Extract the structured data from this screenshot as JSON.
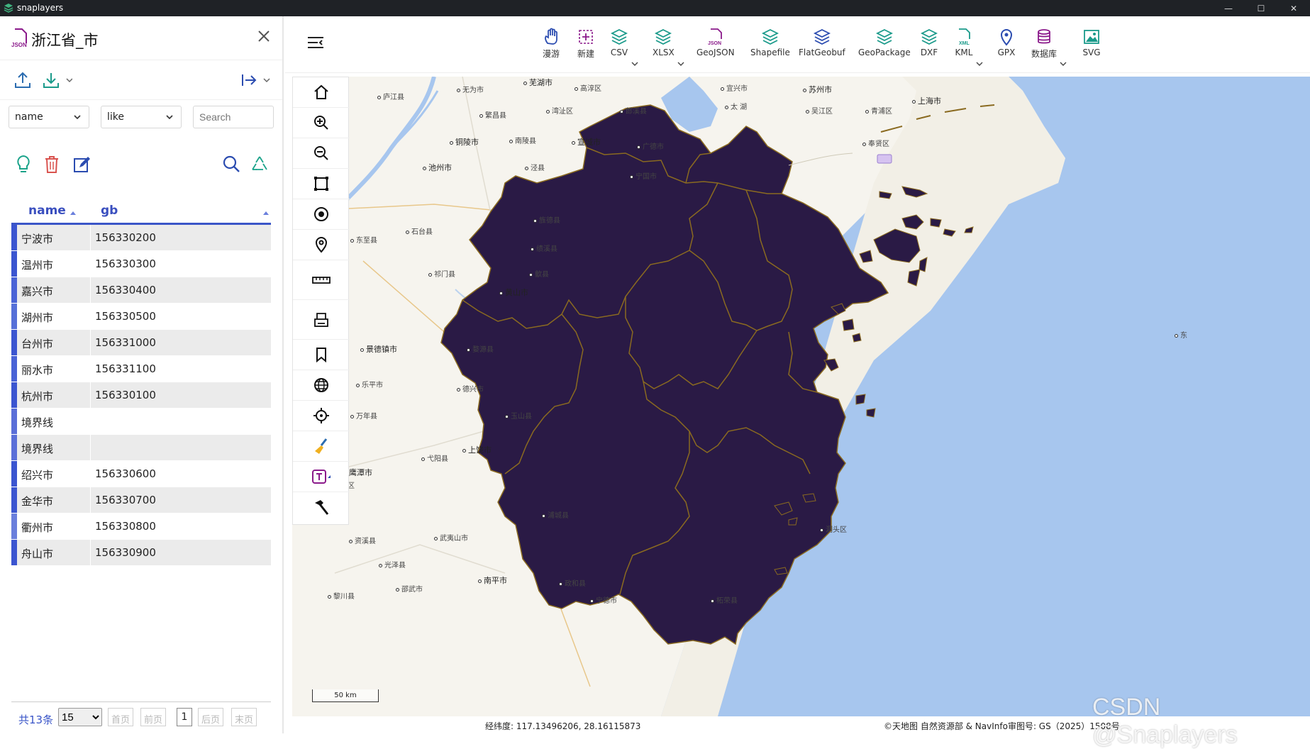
{
  "window": {
    "app_name": "snaplayers",
    "controls": [
      "—",
      "☐",
      "✕"
    ]
  },
  "layer_panel": {
    "title": "浙江省_市",
    "filter": {
      "field": "name",
      "operator": "like",
      "search_placeholder": "Search"
    },
    "columns": [
      "name",
      "gb"
    ],
    "rows": [
      {
        "name": "宁波市",
        "gb": "156330200",
        "color": "#3b55d0"
      },
      {
        "name": "温州市",
        "gb": "156330300",
        "color": "#3b55d0"
      },
      {
        "name": "嘉兴市",
        "gb": "156330400",
        "color": "#4a63d6"
      },
      {
        "name": "湖州市",
        "gb": "156330500",
        "color": "#5670d8"
      },
      {
        "name": "台州市",
        "gb": "156331000",
        "color": "#3b55d0"
      },
      {
        "name": "丽水市",
        "gb": "156331100",
        "color": "#4a63d6"
      },
      {
        "name": "杭州市",
        "gb": "156330100",
        "color": "#3b55d0"
      },
      {
        "name": "境界线",
        "gb": "",
        "color": "#5a6fd8"
      },
      {
        "name": "境界线",
        "gb": "",
        "color": "#5a6fd8"
      },
      {
        "name": "绍兴市",
        "gb": "156330600",
        "color": "#3b55d0"
      },
      {
        "name": "金华市",
        "gb": "156330700",
        "color": "#3b55d0"
      },
      {
        "name": "衢州市",
        "gb": "156330800",
        "color": "#6a7fdc"
      },
      {
        "name": "舟山市",
        "gb": "156330900",
        "color": "#3b55d0"
      }
    ],
    "pager": {
      "total": "共13条",
      "page_size": "15",
      "first": "首页",
      "prev": "前页",
      "current": "1",
      "next": "后页",
      "last": "末页"
    }
  },
  "toolbar": {
    "items": [
      {
        "label": "漫游",
        "icon": "hand-icon",
        "dropdown": false
      },
      {
        "label": "新建",
        "icon": "new-layer-icon",
        "dropdown": false
      },
      {
        "label": "CSV",
        "icon": "csv-layers-icon",
        "dropdown": true
      },
      {
        "label": "XLSX",
        "icon": "xlsx-layers-icon",
        "dropdown": true
      },
      {
        "label": "GeoJSON",
        "icon": "geojson-file-icon",
        "dropdown": false
      },
      {
        "label": "Shapefile",
        "icon": "shapefile-layers-icon",
        "dropdown": false
      },
      {
        "label": "FlatGeobuf",
        "icon": "flatgeobuf-layers-icon",
        "dropdown": false
      },
      {
        "label": "GeoPackage",
        "icon": "geopackage-layers-icon",
        "dropdown": false
      },
      {
        "label": "DXF",
        "icon": "dxf-layers-icon",
        "dropdown": false
      },
      {
        "label": "KML",
        "icon": "kml-file-icon",
        "dropdown": true
      },
      {
        "label": "GPX",
        "icon": "gpx-pin-icon",
        "dropdown": false
      },
      {
        "label": "数据库",
        "icon": "database-icon",
        "dropdown": true
      },
      {
        "label": "SVG",
        "icon": "svg-image-icon",
        "dropdown": false
      }
    ]
  },
  "map": {
    "fill_color": "#2a1a45",
    "border_color": "#8a6a20",
    "water_color": "#a7c6ee",
    "land_color": "#f6f4ee",
    "labels": [
      {
        "text": "芜湖市",
        "cls": ""
      },
      {
        "text": "苏州市",
        "cls": ""
      },
      {
        "text": "上海市",
        "cls": ""
      },
      {
        "text": "太 湖",
        "cls": "sm"
      },
      {
        "text": "铜陵市",
        "cls": ""
      },
      {
        "text": "宣城市",
        "cls": ""
      },
      {
        "text": "池州市",
        "cls": ""
      },
      {
        "text": "黄山市",
        "cls": ""
      },
      {
        "text": "景德镇市",
        "cls": ""
      },
      {
        "text": "上饶市",
        "cls": ""
      },
      {
        "text": "鹰潭市",
        "cls": ""
      },
      {
        "text": "武夷山市",
        "cls": "sm"
      },
      {
        "text": "南平市",
        "cls": ""
      },
      {
        "text": "庐江县",
        "cls": "sm"
      },
      {
        "text": "无为市",
        "cls": "sm"
      },
      {
        "text": "高淳区",
        "cls": "sm"
      },
      {
        "text": "宜兴市",
        "cls": "sm"
      },
      {
        "text": "吴江区",
        "cls": "sm"
      },
      {
        "text": "青浦区",
        "cls": "sm"
      },
      {
        "text": "奉贤区",
        "cls": "sm"
      },
      {
        "text": "繁昌县",
        "cls": "sm"
      },
      {
        "text": "湾沚区",
        "cls": "sm"
      },
      {
        "text": "郎溪县",
        "cls": "sm"
      },
      {
        "text": "南陵县",
        "cls": "sm"
      },
      {
        "text": "广德市",
        "cls": "sm"
      },
      {
        "text": "宁国市",
        "cls": "sm"
      },
      {
        "text": "泾县",
        "cls": "sm"
      },
      {
        "text": "旌德县",
        "cls": "sm"
      },
      {
        "text": "绩溪县",
        "cls": "sm"
      },
      {
        "text": "石台县",
        "cls": "sm"
      },
      {
        "text": "祁门县",
        "cls": "sm"
      },
      {
        "text": "歙县",
        "cls": "sm"
      },
      {
        "text": "东至县",
        "cls": "sm"
      },
      {
        "text": "婺源县",
        "cls": "sm"
      },
      {
        "text": "乐平市",
        "cls": "sm"
      },
      {
        "text": "德兴市",
        "cls": "sm"
      },
      {
        "text": "万年县",
        "cls": "sm"
      },
      {
        "text": "玉山县",
        "cls": "sm"
      },
      {
        "text": "弋阳县",
        "cls": "sm"
      },
      {
        "text": "余江区",
        "cls": "sm"
      },
      {
        "text": "浦城县",
        "cls": "sm"
      },
      {
        "text": "资溪县",
        "cls": "sm"
      },
      {
        "text": "光泽县",
        "cls": "sm"
      },
      {
        "text": "邵武市",
        "cls": "sm"
      },
      {
        "text": "黎川县",
        "cls": "sm"
      },
      {
        "text": "政和县",
        "cls": "sm"
      },
      {
        "text": "宁德市",
        "cls": "sm"
      },
      {
        "text": "柘荣县",
        "cls": "sm"
      },
      {
        "text": "洞头区",
        "cls": "sm"
      },
      {
        "text": "东",
        "cls": "sm"
      }
    ],
    "scale": "50 km"
  },
  "status": {
    "coordinates": "经纬度:  117.13496206, 28.16115873",
    "attribution": "©天地图 自然资源部 & NavInfo审图号: GS（2025）1508号"
  },
  "watermark": "CSDN @Snaplayers"
}
